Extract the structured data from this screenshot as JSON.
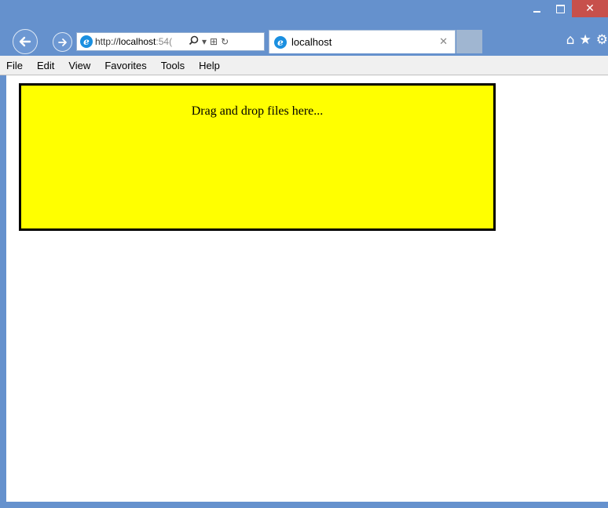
{
  "window": {
    "caption": {
      "close_symbol": "✕"
    }
  },
  "nav": {
    "back_icon": "back-arrow-icon",
    "forward_icon": "forward-arrow-icon",
    "address": {
      "scheme": "http://",
      "host": "localhost",
      "port_partial": ":54("
    },
    "search_icon": "🔍",
    "dropdown_icon": "▾",
    "compat_icon": "⊞",
    "refresh_icon": "↻"
  },
  "tab": {
    "label": "localhost",
    "close": "✕"
  },
  "toolbar_icons": {
    "home": "⌂",
    "favorites": "★",
    "settings": "⚙"
  },
  "menu": [
    "File",
    "Edit",
    "View",
    "Favorites",
    "Tools",
    "Help"
  ],
  "page": {
    "drop_text": "Drag and drop files here...",
    "drop_bg": "#ffff00"
  },
  "colors": {
    "frame": "#6591cd",
    "close_button": "#c7504b"
  }
}
